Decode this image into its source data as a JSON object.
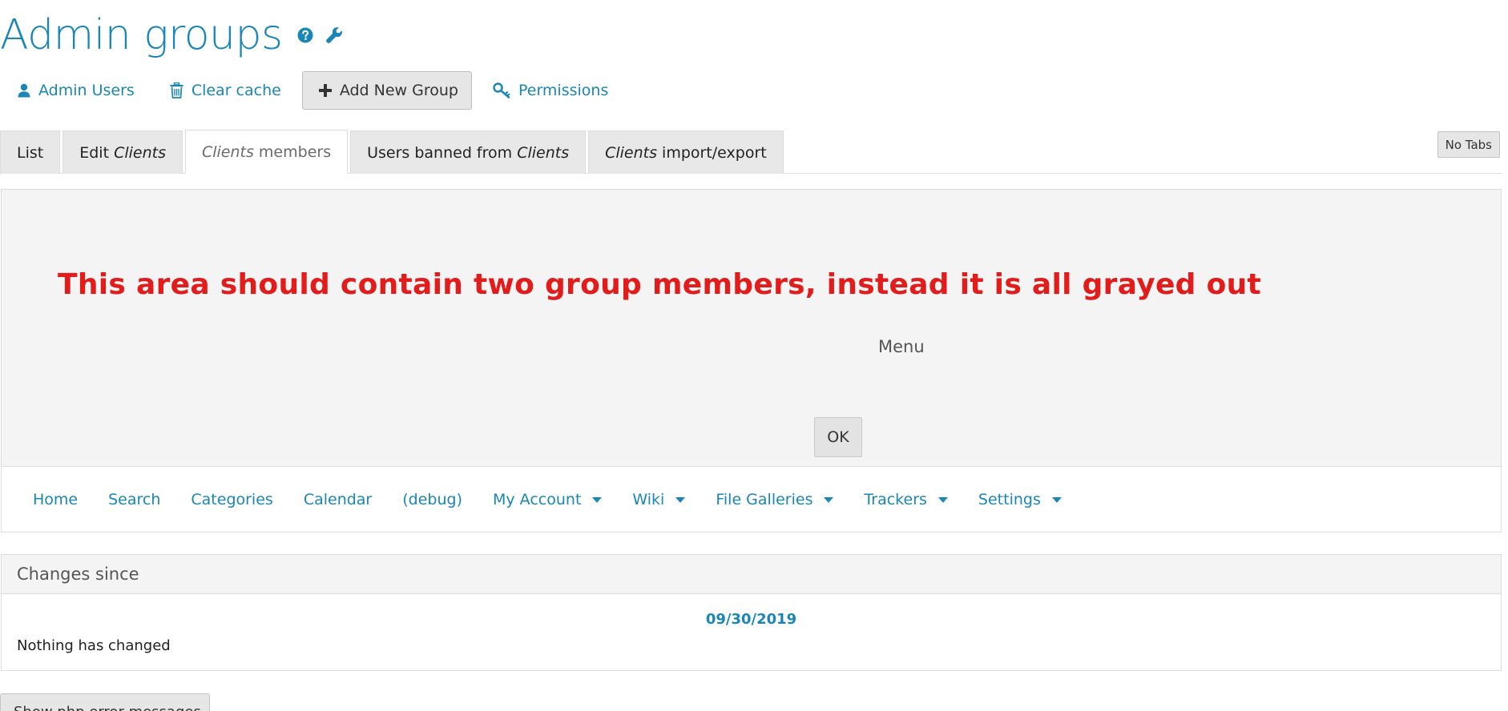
{
  "header": {
    "title": "Admin groups",
    "icons": [
      "question-circle-icon",
      "wrench-icon"
    ]
  },
  "toolbar": {
    "admin_users": "Admin Users",
    "clear_cache": "Clear cache",
    "add_new_group": "Add New Group",
    "permissions": "Permissions"
  },
  "tabs": {
    "list": "List",
    "edit_prefix": "Edit",
    "edit_group": "Clients",
    "members_group": "Clients",
    "members_suffix": "members",
    "banned_prefix": "Users banned from",
    "banned_group": "Clients",
    "import_group": "Clients",
    "import_suffix": "import/export",
    "no_tabs": "No Tabs"
  },
  "panel": {
    "annotation": "This area should contain two group members, instead it is all grayed out",
    "menu_label": "Menu",
    "ok_label": "OK"
  },
  "nav": {
    "items": [
      {
        "label": "Home",
        "dropdown": false
      },
      {
        "label": "Search",
        "dropdown": false
      },
      {
        "label": "Categories",
        "dropdown": false
      },
      {
        "label": "Calendar",
        "dropdown": false
      },
      {
        "label": "(debug)",
        "dropdown": false
      },
      {
        "label": "My Account",
        "dropdown": true
      },
      {
        "label": "Wiki",
        "dropdown": true
      },
      {
        "label": "File Galleries",
        "dropdown": true
      },
      {
        "label": "Trackers",
        "dropdown": true
      },
      {
        "label": "Settings",
        "dropdown": true
      }
    ]
  },
  "changes": {
    "header": "Changes since",
    "date": "09/30/2019",
    "message": "Nothing has changed"
  },
  "footer": {
    "php_button": "Show php error messages"
  },
  "colors": {
    "link": "#1a86b8",
    "annotation": "#e21b1b",
    "panel_bg": "#f4f4f4",
    "tab_bg": "#e8e8e8"
  }
}
